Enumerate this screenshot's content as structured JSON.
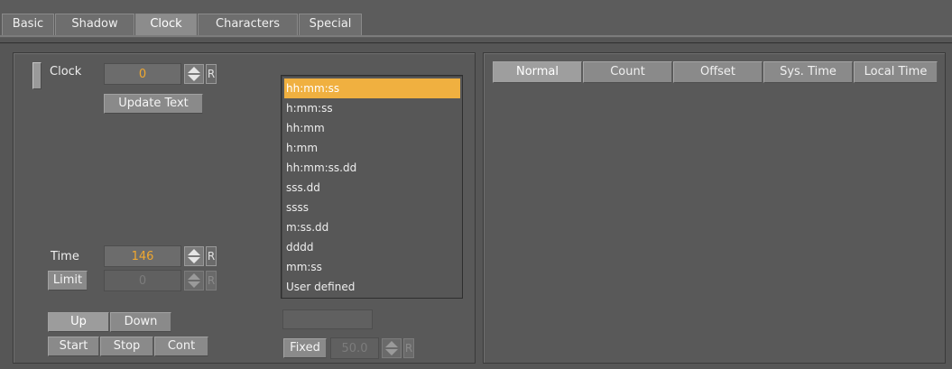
{
  "tabs": [
    {
      "label": "Basic"
    },
    {
      "label": "Shadow"
    },
    {
      "label": "Clock"
    },
    {
      "label": "Characters"
    },
    {
      "label": "Special"
    }
  ],
  "active_tab": "Clock",
  "clock": {
    "label": "Clock",
    "value": "0",
    "reset_label": "R",
    "update_text_label": "Update Text"
  },
  "time": {
    "label": "Time",
    "value": "146",
    "reset_label": "R"
  },
  "limit": {
    "button_label": "Limit",
    "value": "0",
    "reset_label": "R"
  },
  "direction": {
    "up_label": "Up",
    "down_label": "Down",
    "selected": "Up"
  },
  "controls": {
    "start_label": "Start",
    "stop_label": "Stop",
    "cont_label": "Cont"
  },
  "formats": {
    "items": [
      "hh:mm:ss",
      "h:mm:ss",
      "hh:mm",
      "h:mm",
      "hh:mm:ss.dd",
      "sss.dd",
      "ssss",
      "m:ss.dd",
      "dddd",
      "mm:ss",
      "User defined"
    ],
    "selected": "hh:mm:ss",
    "custom_value": ""
  },
  "fixed": {
    "button_label": "Fixed",
    "value": "50.0",
    "reset_label": "R"
  },
  "mode_tabs": [
    {
      "label": "Normal"
    },
    {
      "label": "Count"
    },
    {
      "label": "Offset"
    },
    {
      "label": "Sys. Time"
    },
    {
      "label": "Local Time"
    }
  ],
  "selected_mode": "Normal",
  "colors": {
    "accent": "#f0b040",
    "value_text": "#f0a830",
    "background": "#565656"
  },
  "icons": {
    "spin": "up-down-arrows-icon",
    "reset": "reset-R-icon"
  }
}
